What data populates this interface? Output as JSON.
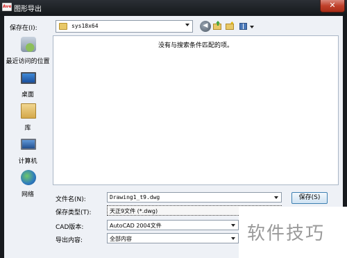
{
  "window": {
    "title": "图形导出",
    "app_icon_text": "Ave",
    "close_glyph": "✕"
  },
  "toolbar": {
    "save_in_label": "保存在(I):",
    "folder_name": "sys18x64",
    "back_glyph": "◀"
  },
  "places": [
    {
      "label": "最近访问的位置",
      "icon": "recent-places-icon"
    },
    {
      "label": "桌面",
      "icon": "desktop-icon"
    },
    {
      "label": "库",
      "icon": "library-icon"
    },
    {
      "label": "计算机",
      "icon": "computer-icon"
    },
    {
      "label": "网络",
      "icon": "network-icon"
    }
  ],
  "file_list": {
    "empty_message": "没有与搜索条件匹配的项。"
  },
  "fields": {
    "filename_label": "文件名(N):",
    "filename_value": "Drawing1_t9.dwg",
    "filetype_label": "保存类型(T):",
    "filetype_value": "天正9文件 (*.dwg)",
    "cad_version_label": "CAD版本:",
    "cad_version_value": "AutoCAD 2004文件",
    "export_content_label": "导出内容:",
    "export_content_value": "全部内容"
  },
  "buttons": {
    "save_label": "保存(S)"
  },
  "watermark": {
    "text": "软件技巧"
  }
}
